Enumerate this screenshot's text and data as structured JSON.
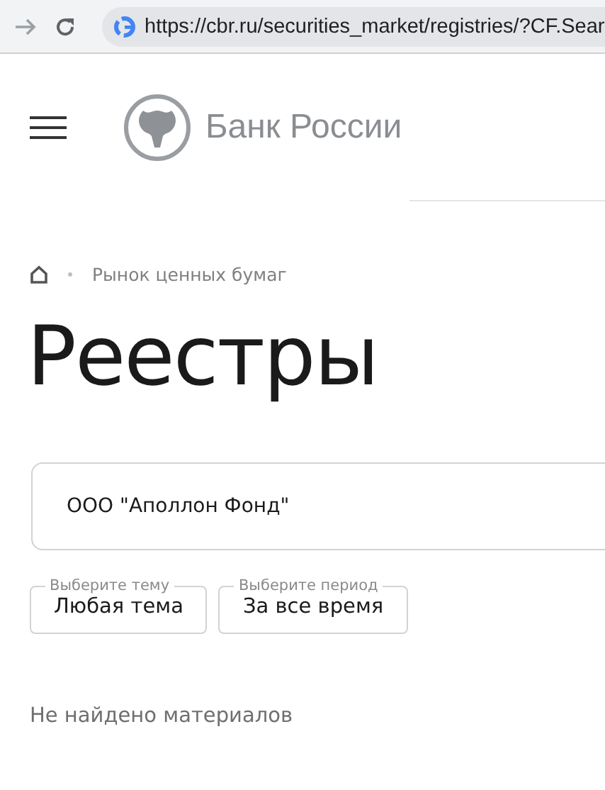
{
  "browser": {
    "url": "https://cbr.ru/securities_market/registries/?CF.Sear"
  },
  "header": {
    "brand": "Банк России"
  },
  "breadcrumb": [
    {
      "label": "Рынок ценных бумаг"
    }
  ],
  "title": "Реестры",
  "search": {
    "value": "ООО \"Аполлон Фонд\""
  },
  "filters": [
    {
      "legend": "Выберите тему",
      "value": "Любая тема"
    },
    {
      "legend": "Выберите период",
      "value": "За все время"
    }
  ],
  "empty_message": "Не найдено материалов"
}
